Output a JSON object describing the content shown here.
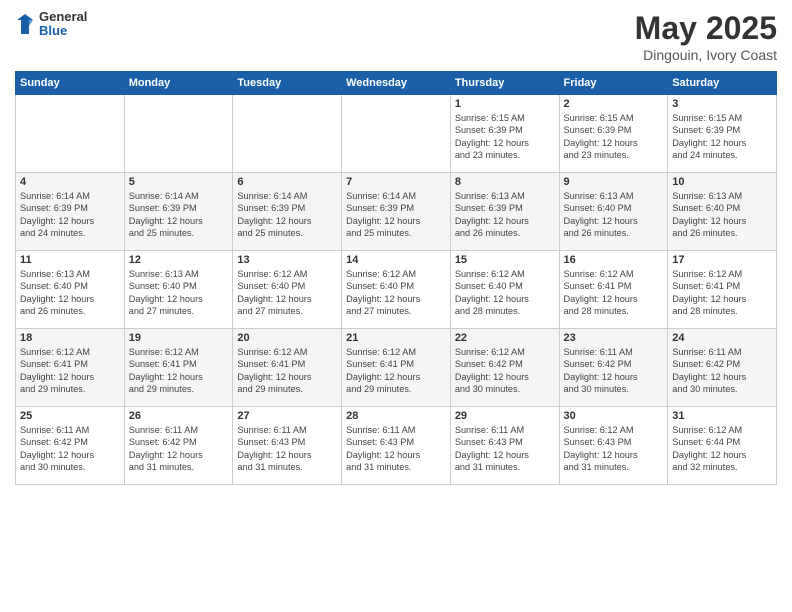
{
  "header": {
    "logo_general": "General",
    "logo_blue": "Blue",
    "month": "May 2025",
    "location": "Dingouin, Ivory Coast"
  },
  "days_of_week": [
    "Sunday",
    "Monday",
    "Tuesday",
    "Wednesday",
    "Thursday",
    "Friday",
    "Saturday"
  ],
  "weeks": [
    [
      {
        "day": "",
        "info": ""
      },
      {
        "day": "",
        "info": ""
      },
      {
        "day": "",
        "info": ""
      },
      {
        "day": "",
        "info": ""
      },
      {
        "day": "1",
        "info": "Sunrise: 6:15 AM\nSunset: 6:39 PM\nDaylight: 12 hours\nand 23 minutes."
      },
      {
        "day": "2",
        "info": "Sunrise: 6:15 AM\nSunset: 6:39 PM\nDaylight: 12 hours\nand 23 minutes."
      },
      {
        "day": "3",
        "info": "Sunrise: 6:15 AM\nSunset: 6:39 PM\nDaylight: 12 hours\nand 24 minutes."
      }
    ],
    [
      {
        "day": "4",
        "info": "Sunrise: 6:14 AM\nSunset: 6:39 PM\nDaylight: 12 hours\nand 24 minutes."
      },
      {
        "day": "5",
        "info": "Sunrise: 6:14 AM\nSunset: 6:39 PM\nDaylight: 12 hours\nand 25 minutes."
      },
      {
        "day": "6",
        "info": "Sunrise: 6:14 AM\nSunset: 6:39 PM\nDaylight: 12 hours\nand 25 minutes."
      },
      {
        "day": "7",
        "info": "Sunrise: 6:14 AM\nSunset: 6:39 PM\nDaylight: 12 hours\nand 25 minutes."
      },
      {
        "day": "8",
        "info": "Sunrise: 6:13 AM\nSunset: 6:39 PM\nDaylight: 12 hours\nand 26 minutes."
      },
      {
        "day": "9",
        "info": "Sunrise: 6:13 AM\nSunset: 6:40 PM\nDaylight: 12 hours\nand 26 minutes."
      },
      {
        "day": "10",
        "info": "Sunrise: 6:13 AM\nSunset: 6:40 PM\nDaylight: 12 hours\nand 26 minutes."
      }
    ],
    [
      {
        "day": "11",
        "info": "Sunrise: 6:13 AM\nSunset: 6:40 PM\nDaylight: 12 hours\nand 26 minutes."
      },
      {
        "day": "12",
        "info": "Sunrise: 6:13 AM\nSunset: 6:40 PM\nDaylight: 12 hours\nand 27 minutes."
      },
      {
        "day": "13",
        "info": "Sunrise: 6:12 AM\nSunset: 6:40 PM\nDaylight: 12 hours\nand 27 minutes."
      },
      {
        "day": "14",
        "info": "Sunrise: 6:12 AM\nSunset: 6:40 PM\nDaylight: 12 hours\nand 27 minutes."
      },
      {
        "day": "15",
        "info": "Sunrise: 6:12 AM\nSunset: 6:40 PM\nDaylight: 12 hours\nand 28 minutes."
      },
      {
        "day": "16",
        "info": "Sunrise: 6:12 AM\nSunset: 6:41 PM\nDaylight: 12 hours\nand 28 minutes."
      },
      {
        "day": "17",
        "info": "Sunrise: 6:12 AM\nSunset: 6:41 PM\nDaylight: 12 hours\nand 28 minutes."
      }
    ],
    [
      {
        "day": "18",
        "info": "Sunrise: 6:12 AM\nSunset: 6:41 PM\nDaylight: 12 hours\nand 29 minutes."
      },
      {
        "day": "19",
        "info": "Sunrise: 6:12 AM\nSunset: 6:41 PM\nDaylight: 12 hours\nand 29 minutes."
      },
      {
        "day": "20",
        "info": "Sunrise: 6:12 AM\nSunset: 6:41 PM\nDaylight: 12 hours\nand 29 minutes."
      },
      {
        "day": "21",
        "info": "Sunrise: 6:12 AM\nSunset: 6:41 PM\nDaylight: 12 hours\nand 29 minutes."
      },
      {
        "day": "22",
        "info": "Sunrise: 6:12 AM\nSunset: 6:42 PM\nDaylight: 12 hours\nand 30 minutes."
      },
      {
        "day": "23",
        "info": "Sunrise: 6:11 AM\nSunset: 6:42 PM\nDaylight: 12 hours\nand 30 minutes."
      },
      {
        "day": "24",
        "info": "Sunrise: 6:11 AM\nSunset: 6:42 PM\nDaylight: 12 hours\nand 30 minutes."
      }
    ],
    [
      {
        "day": "25",
        "info": "Sunrise: 6:11 AM\nSunset: 6:42 PM\nDaylight: 12 hours\nand 30 minutes."
      },
      {
        "day": "26",
        "info": "Sunrise: 6:11 AM\nSunset: 6:42 PM\nDaylight: 12 hours\nand 31 minutes."
      },
      {
        "day": "27",
        "info": "Sunrise: 6:11 AM\nSunset: 6:43 PM\nDaylight: 12 hours\nand 31 minutes."
      },
      {
        "day": "28",
        "info": "Sunrise: 6:11 AM\nSunset: 6:43 PM\nDaylight: 12 hours\nand 31 minutes."
      },
      {
        "day": "29",
        "info": "Sunrise: 6:11 AM\nSunset: 6:43 PM\nDaylight: 12 hours\nand 31 minutes."
      },
      {
        "day": "30",
        "info": "Sunrise: 6:12 AM\nSunset: 6:43 PM\nDaylight: 12 hours\nand 31 minutes."
      },
      {
        "day": "31",
        "info": "Sunrise: 6:12 AM\nSunset: 6:44 PM\nDaylight: 12 hours\nand 32 minutes."
      }
    ]
  ]
}
